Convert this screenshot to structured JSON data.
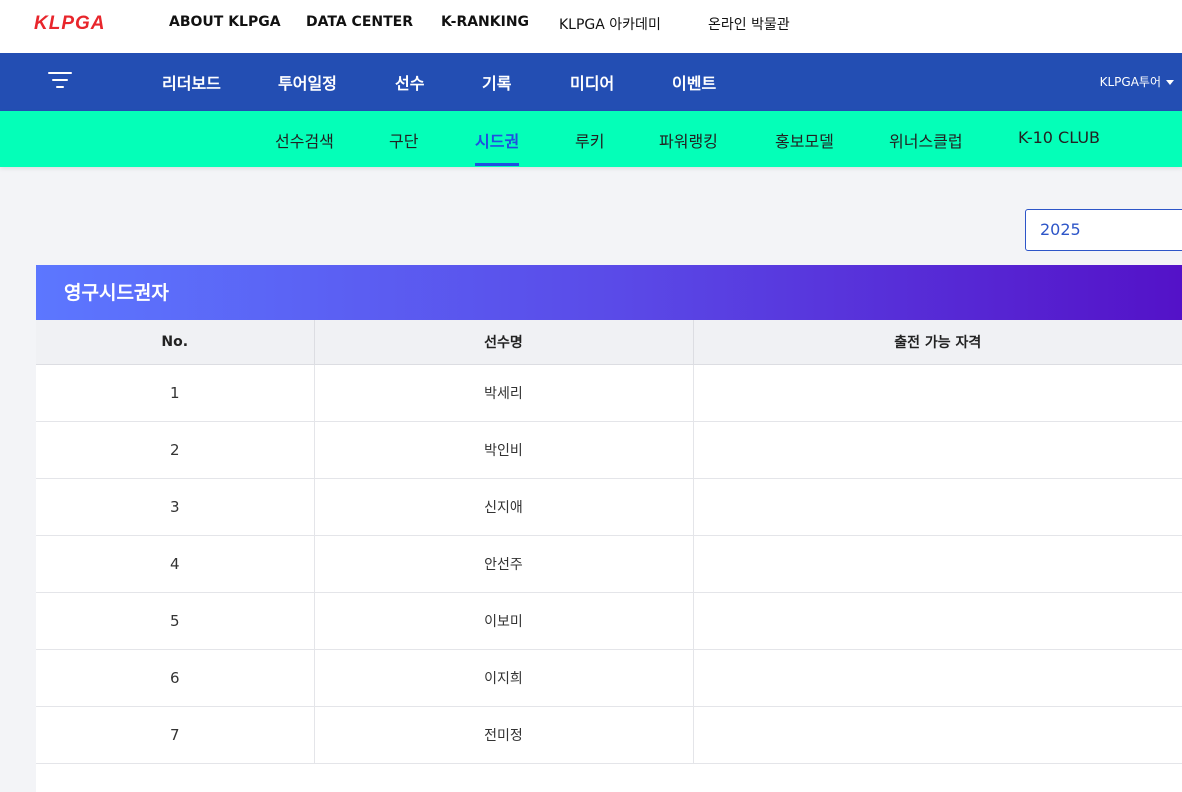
{
  "brand": {
    "logo_text": "KLPGA",
    "logo_color": "#e8262c"
  },
  "top_links": [
    "ABOUT KLPGA",
    "DATA CENTER",
    "K-RANKING",
    "KLPGA 아카데미",
    "온라인 박물관"
  ],
  "main_nav": {
    "items": [
      "리더보드",
      "투어일정",
      "선수",
      "기록",
      "미디어",
      "이벤트"
    ],
    "tour_select": "KLPGA투어",
    "bg_color": "#234eb3"
  },
  "sub_nav": {
    "items": [
      "선수검색",
      "구단",
      "시드권",
      "루키",
      "파워랭킹",
      "홍보모델",
      "위너스클럽",
      "K-10 CLUB"
    ],
    "active": "시드권",
    "bg_color": "#04ffb8",
    "active_color": "#1f4fe0"
  },
  "year_select": {
    "value": "2025"
  },
  "section": {
    "title": "영구시드권자",
    "columns": [
      "No.",
      "선수명",
      "출전 가능 자격"
    ],
    "rows": [
      {
        "no": "1",
        "name": "박세리",
        "qual": ""
      },
      {
        "no": "2",
        "name": "박인비",
        "qual": ""
      },
      {
        "no": "3",
        "name": "신지애",
        "qual": ""
      },
      {
        "no": "4",
        "name": "안선주",
        "qual": ""
      },
      {
        "no": "5",
        "name": "이보미",
        "qual": ""
      },
      {
        "no": "6",
        "name": "이지희",
        "qual": ""
      },
      {
        "no": "7",
        "name": "전미정",
        "qual": ""
      }
    ]
  }
}
